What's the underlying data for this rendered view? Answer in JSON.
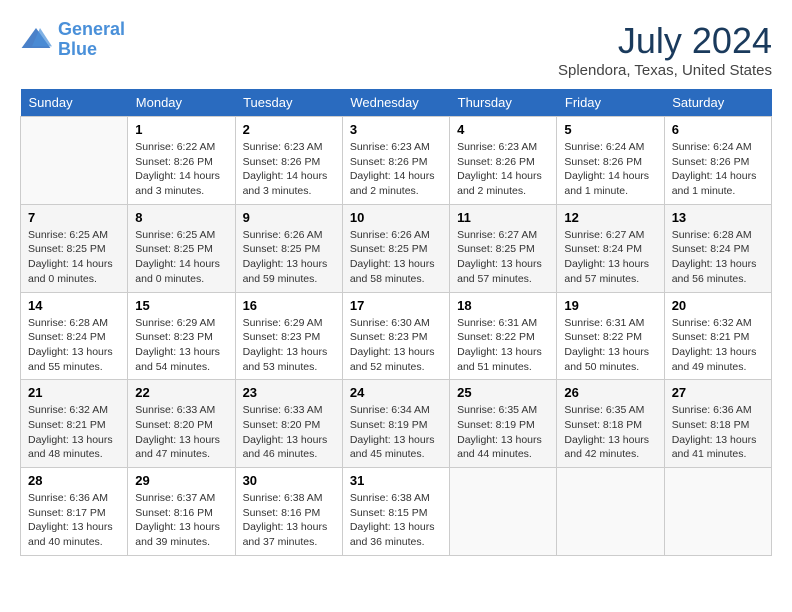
{
  "logo": {
    "line1": "General",
    "line2": "Blue"
  },
  "title": "July 2024",
  "location": "Splendora, Texas, United States",
  "weekdays": [
    "Sunday",
    "Monday",
    "Tuesday",
    "Wednesday",
    "Thursday",
    "Friday",
    "Saturday"
  ],
  "weeks": [
    [
      {
        "day": "",
        "info": ""
      },
      {
        "day": "1",
        "info": "Sunrise: 6:22 AM\nSunset: 8:26 PM\nDaylight: 14 hours\nand 3 minutes."
      },
      {
        "day": "2",
        "info": "Sunrise: 6:23 AM\nSunset: 8:26 PM\nDaylight: 14 hours\nand 3 minutes."
      },
      {
        "day": "3",
        "info": "Sunrise: 6:23 AM\nSunset: 8:26 PM\nDaylight: 14 hours\nand 2 minutes."
      },
      {
        "day": "4",
        "info": "Sunrise: 6:23 AM\nSunset: 8:26 PM\nDaylight: 14 hours\nand 2 minutes."
      },
      {
        "day": "5",
        "info": "Sunrise: 6:24 AM\nSunset: 8:26 PM\nDaylight: 14 hours\nand 1 minute."
      },
      {
        "day": "6",
        "info": "Sunrise: 6:24 AM\nSunset: 8:26 PM\nDaylight: 14 hours\nand 1 minute."
      }
    ],
    [
      {
        "day": "7",
        "info": "Sunrise: 6:25 AM\nSunset: 8:25 PM\nDaylight: 14 hours\nand 0 minutes."
      },
      {
        "day": "8",
        "info": "Sunrise: 6:25 AM\nSunset: 8:25 PM\nDaylight: 14 hours\nand 0 minutes."
      },
      {
        "day": "9",
        "info": "Sunrise: 6:26 AM\nSunset: 8:25 PM\nDaylight: 13 hours\nand 59 minutes."
      },
      {
        "day": "10",
        "info": "Sunrise: 6:26 AM\nSunset: 8:25 PM\nDaylight: 13 hours\nand 58 minutes."
      },
      {
        "day": "11",
        "info": "Sunrise: 6:27 AM\nSunset: 8:25 PM\nDaylight: 13 hours\nand 57 minutes."
      },
      {
        "day": "12",
        "info": "Sunrise: 6:27 AM\nSunset: 8:24 PM\nDaylight: 13 hours\nand 57 minutes."
      },
      {
        "day": "13",
        "info": "Sunrise: 6:28 AM\nSunset: 8:24 PM\nDaylight: 13 hours\nand 56 minutes."
      }
    ],
    [
      {
        "day": "14",
        "info": "Sunrise: 6:28 AM\nSunset: 8:24 PM\nDaylight: 13 hours\nand 55 minutes."
      },
      {
        "day": "15",
        "info": "Sunrise: 6:29 AM\nSunset: 8:23 PM\nDaylight: 13 hours\nand 54 minutes."
      },
      {
        "day": "16",
        "info": "Sunrise: 6:29 AM\nSunset: 8:23 PM\nDaylight: 13 hours\nand 53 minutes."
      },
      {
        "day": "17",
        "info": "Sunrise: 6:30 AM\nSunset: 8:23 PM\nDaylight: 13 hours\nand 52 minutes."
      },
      {
        "day": "18",
        "info": "Sunrise: 6:31 AM\nSunset: 8:22 PM\nDaylight: 13 hours\nand 51 minutes."
      },
      {
        "day": "19",
        "info": "Sunrise: 6:31 AM\nSunset: 8:22 PM\nDaylight: 13 hours\nand 50 minutes."
      },
      {
        "day": "20",
        "info": "Sunrise: 6:32 AM\nSunset: 8:21 PM\nDaylight: 13 hours\nand 49 minutes."
      }
    ],
    [
      {
        "day": "21",
        "info": "Sunrise: 6:32 AM\nSunset: 8:21 PM\nDaylight: 13 hours\nand 48 minutes."
      },
      {
        "day": "22",
        "info": "Sunrise: 6:33 AM\nSunset: 8:20 PM\nDaylight: 13 hours\nand 47 minutes."
      },
      {
        "day": "23",
        "info": "Sunrise: 6:33 AM\nSunset: 8:20 PM\nDaylight: 13 hours\nand 46 minutes."
      },
      {
        "day": "24",
        "info": "Sunrise: 6:34 AM\nSunset: 8:19 PM\nDaylight: 13 hours\nand 45 minutes."
      },
      {
        "day": "25",
        "info": "Sunrise: 6:35 AM\nSunset: 8:19 PM\nDaylight: 13 hours\nand 44 minutes."
      },
      {
        "day": "26",
        "info": "Sunrise: 6:35 AM\nSunset: 8:18 PM\nDaylight: 13 hours\nand 42 minutes."
      },
      {
        "day": "27",
        "info": "Sunrise: 6:36 AM\nSunset: 8:18 PM\nDaylight: 13 hours\nand 41 minutes."
      }
    ],
    [
      {
        "day": "28",
        "info": "Sunrise: 6:36 AM\nSunset: 8:17 PM\nDaylight: 13 hours\nand 40 minutes."
      },
      {
        "day": "29",
        "info": "Sunrise: 6:37 AM\nSunset: 8:16 PM\nDaylight: 13 hours\nand 39 minutes."
      },
      {
        "day": "30",
        "info": "Sunrise: 6:38 AM\nSunset: 8:16 PM\nDaylight: 13 hours\nand 37 minutes."
      },
      {
        "day": "31",
        "info": "Sunrise: 6:38 AM\nSunset: 8:15 PM\nDaylight: 13 hours\nand 36 minutes."
      },
      {
        "day": "",
        "info": ""
      },
      {
        "day": "",
        "info": ""
      },
      {
        "day": "",
        "info": ""
      }
    ]
  ]
}
